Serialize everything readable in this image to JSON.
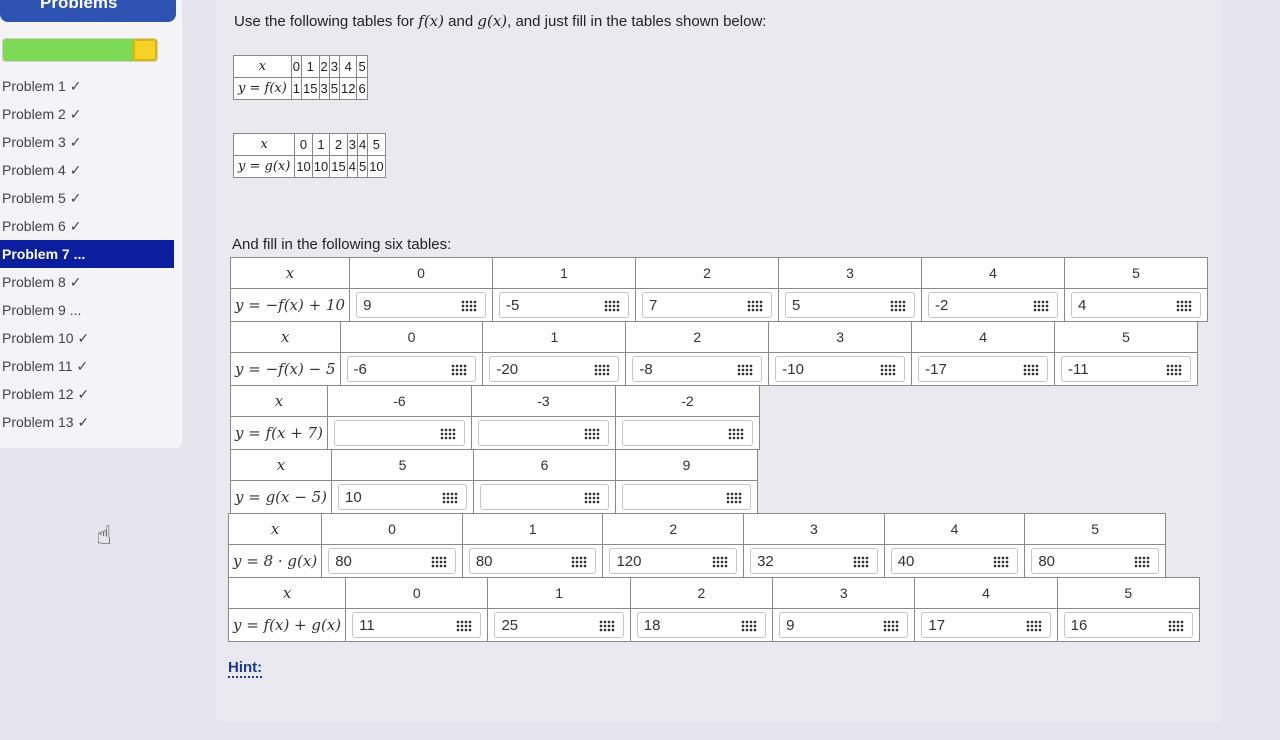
{
  "sidebar": {
    "header": "Problems",
    "problems": [
      {
        "label": "Problem 1 ✓",
        "active": false
      },
      {
        "label": "Problem 2 ✓",
        "active": false
      },
      {
        "label": "Problem 3 ✓",
        "active": false
      },
      {
        "label": "Problem 4 ✓",
        "active": false
      },
      {
        "label": "Problem 5 ✓",
        "active": false
      },
      {
        "label": "Problem 6 ✓",
        "active": false
      },
      {
        "label": "Problem 7 ...",
        "active": true
      },
      {
        "label": "Problem 8 ✓",
        "active": false
      },
      {
        "label": "Problem 9 ...",
        "active": false
      },
      {
        "label": "Problem 10 ✓",
        "active": false
      },
      {
        "label": "Problem 11 ✓",
        "active": false
      },
      {
        "label": "Problem 12 ✓",
        "active": false
      },
      {
        "label": "Problem 13 ✓",
        "active": false
      }
    ]
  },
  "instructions": {
    "text_a": "Use the following tables for ",
    "f": "f(x)",
    "and": " and ",
    "g": "g(x)",
    "text_b": ", and just fill in the tables shown below:"
  },
  "given_tables": [
    {
      "header": "x",
      "row_label": "y = f(x)",
      "x": [
        "0",
        "1",
        "2",
        "3",
        "4",
        "5"
      ],
      "y": [
        "1",
        "15",
        "3",
        "5",
        "12",
        "6"
      ]
    },
    {
      "header": "x",
      "row_label": "y = g(x)",
      "x": [
        "0",
        "1",
        "2",
        "3",
        "4",
        "5"
      ],
      "y": [
        "10",
        "10",
        "15",
        "4",
        "5",
        "10"
      ]
    }
  ],
  "fill_label": "And fill in the following six tables:",
  "fill_tables": [
    {
      "header": "x",
      "row_label": "y = −f(x) + 10",
      "x": [
        "0",
        "1",
        "2",
        "3",
        "4",
        "5"
      ],
      "y": [
        "9",
        "-5",
        "7",
        "5",
        "-2",
        "4"
      ]
    },
    {
      "header": "x",
      "row_label": "y = −f(x) − 5",
      "x": [
        "0",
        "1",
        "2",
        "3",
        "4",
        "5"
      ],
      "y": [
        "-6",
        "-20",
        "-8",
        "-10",
        "-17",
        "-11"
      ]
    },
    {
      "header": "x",
      "row_label": "y = f(x + 7)",
      "x": [
        "-6",
        "-3",
        "-2"
      ],
      "y": [
        "",
        "",
        ""
      ]
    },
    {
      "header": "x",
      "row_label": "y = g(x − 5)",
      "x": [
        "5",
        "6",
        "9"
      ],
      "y": [
        "10",
        "",
        ""
      ]
    },
    {
      "header": "x",
      "row_label": "y = 8 · g(x)",
      "x": [
        "0",
        "1",
        "2",
        "3",
        "4",
        "5"
      ],
      "y": [
        "80",
        "80",
        "120",
        "32",
        "40",
        "80"
      ]
    },
    {
      "header": "x",
      "row_label": "y = f(x) + g(x)",
      "x": [
        "0",
        "1",
        "2",
        "3",
        "4",
        "5"
      ],
      "y": [
        "11",
        "25",
        "18",
        "9",
        "17",
        "16"
      ]
    }
  ],
  "hint_label": "Hint:",
  "colors": {
    "sidebar_header": "#2e53b3",
    "active_item": "#0b1f9e",
    "progress": "#7ed957",
    "progress_cap": "#f4d229"
  }
}
